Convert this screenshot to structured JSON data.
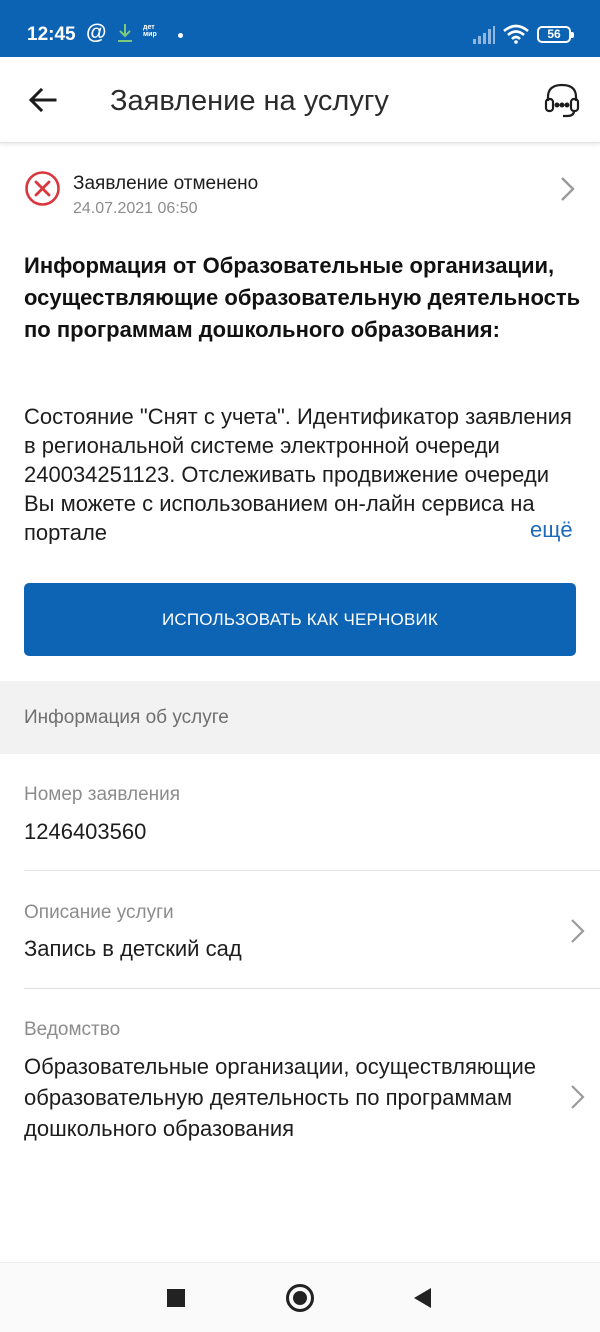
{
  "status_bar": {
    "time": "12:45",
    "at_symbol": "@",
    "detmir_logo": "дет мир",
    "battery": "56"
  },
  "app_bar": {
    "title": "Заявление на услугу",
    "back_icon": "arrow-left-icon",
    "support_icon": "headset-icon"
  },
  "status": {
    "text": "Заявление отменено",
    "date": "24.07.2021 06:50",
    "color": "#d9363e"
  },
  "info": {
    "heading": "Информация от Образовательные организации, осуществляющие образовательную деятельность по программам дошкольного образования:",
    "body": "Состояние \"Снят с учета\". Идентификатор заявления в региональной системе электронной очереди 240034251123. Отслеживать продвижение очереди Вы можете с использованием он-лайн сервиса на портале",
    "more_label": "ещё"
  },
  "draft_button": {
    "label": "ИСПОЛЬЗОВАТЬ КАК ЧЕРНОВИК",
    "color": "#0d64b4"
  },
  "service_info": {
    "section_title": "Информация об услуге",
    "fields": [
      {
        "label": "Номер заявления",
        "value": "1246403560"
      },
      {
        "label": "Описание услуги",
        "value": "Запись в детский сад"
      },
      {
        "label": "Ведомство",
        "value": "Образовательные организации, осуществляющие образовательную деятельность по программам дошкольного образования"
      }
    ]
  },
  "colors": {
    "brand": "#0d63b3",
    "link": "#1d6bb8"
  }
}
